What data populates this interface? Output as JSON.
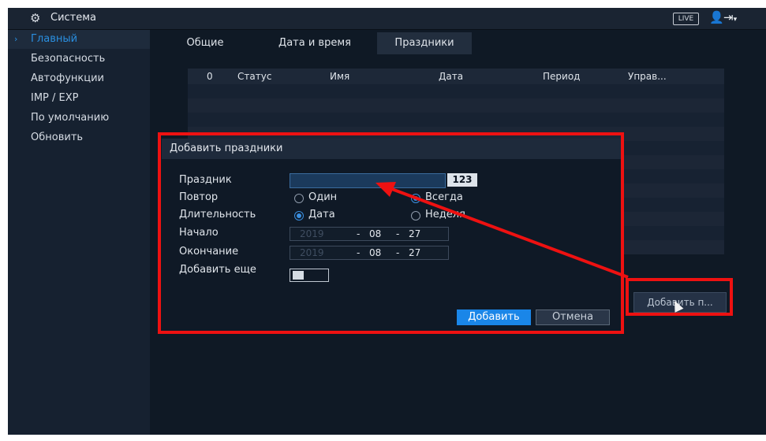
{
  "header": {
    "title": "Система",
    "live_badge": "LIVE"
  },
  "sidebar": {
    "items": [
      {
        "label": "Главный",
        "active": true
      },
      {
        "label": "Безопасность"
      },
      {
        "label": "Автофункции"
      },
      {
        "label": "IMP / EXP"
      },
      {
        "label": "По умолчанию"
      },
      {
        "label": "Обновить"
      }
    ]
  },
  "tabs": [
    {
      "label": "Общие"
    },
    {
      "label": "Дата и время"
    },
    {
      "label": "Праздники",
      "selected": true
    }
  ],
  "table": {
    "columns": [
      "0",
      "Статус",
      "Имя",
      "Дата",
      "Период",
      "Управ..."
    ],
    "rows": []
  },
  "add_button": {
    "label": "Добавить п..."
  },
  "dialog": {
    "title": "Добавить праздники",
    "fields": {
      "holiday_label": "Праздник",
      "holiday_value": "",
      "keyboard_badge": "123",
      "repeat_label": "Повтор",
      "repeat_options": [
        "Один",
        "Всегда"
      ],
      "repeat_selected": "Всегда",
      "duration_label": "Длительность",
      "duration_options": [
        "Дата",
        "Неделя"
      ],
      "duration_selected": "Дата",
      "start_label": "Начало",
      "start": {
        "year": "2019",
        "month": "08",
        "day": "27"
      },
      "end_label": "Окончание",
      "end": {
        "year": "2019",
        "month": "08",
        "day": "27"
      },
      "add_more_label": "Добавить еще"
    },
    "buttons": {
      "ok": "Добавить",
      "cancel": "Отмена"
    }
  },
  "colors": {
    "accent": "#1a86e8",
    "highlight": "#ee1111",
    "background": "#0c1520"
  }
}
